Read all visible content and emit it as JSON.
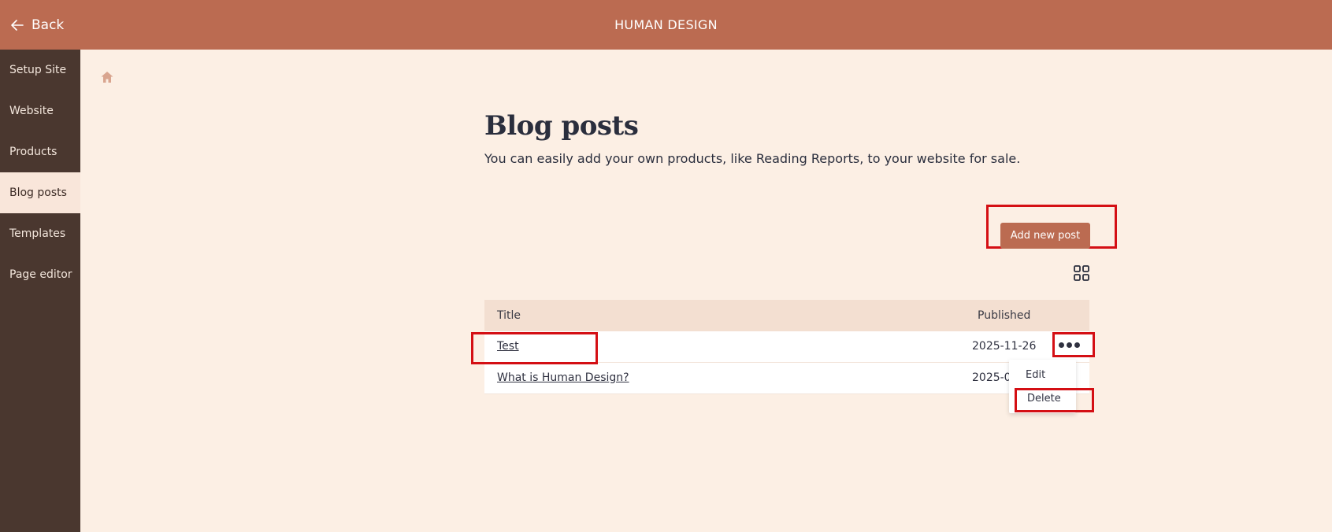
{
  "header": {
    "back_label": "Back",
    "app_title": "HUMAN DESIGN"
  },
  "sidebar": {
    "items": [
      {
        "label": "Setup Site",
        "active": false
      },
      {
        "label": "Website",
        "active": false
      },
      {
        "label": "Products",
        "active": false
      },
      {
        "label": "Blog posts",
        "active": true
      },
      {
        "label": "Templates",
        "active": false
      },
      {
        "label": "Page editor",
        "active": false
      }
    ]
  },
  "main": {
    "title": "Blog posts",
    "subtitle": "You can easily add your own products, like Reading Reports, to your website for sale.",
    "add_button_label": "Add new post",
    "table": {
      "headers": {
        "title": "Title",
        "published": "Published"
      },
      "rows": [
        {
          "title": "Test",
          "published": "2025-11-26"
        },
        {
          "title": "What is Human Design?",
          "published": "2025-09"
        }
      ]
    },
    "row_menu": {
      "edit_label": "Edit",
      "delete_label": "Delete"
    }
  },
  "icons": {
    "back": "arrow-left-icon",
    "home": "home-icon",
    "view_toggle": "grid-view-icon",
    "row_actions": "more-horizontal-icon"
  },
  "colors": {
    "brand": "#bb6b51",
    "sidebar_bg": "#4a372f",
    "page_bg": "#fcefe4",
    "highlight": "#d40f14"
  }
}
